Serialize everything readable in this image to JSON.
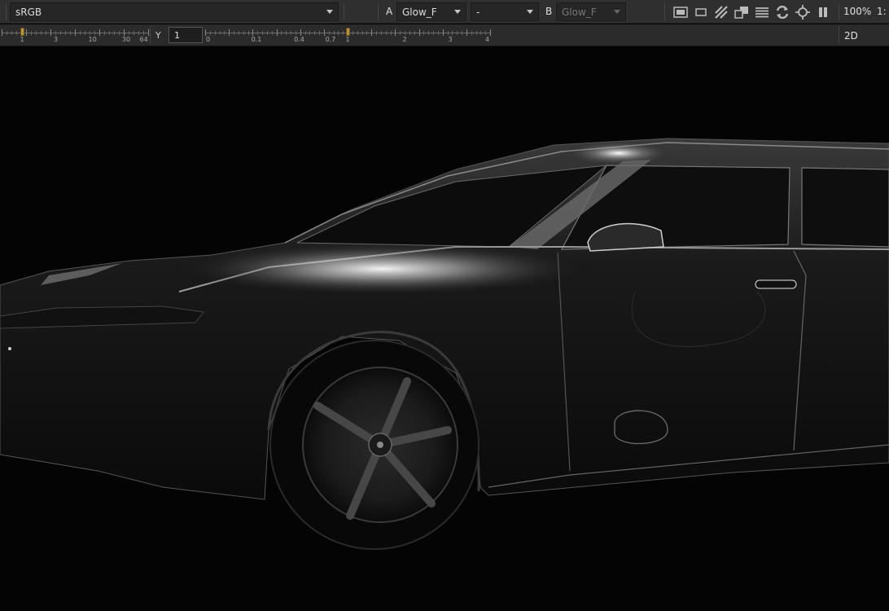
{
  "toolbar": {
    "colorspace": "sRGB",
    "a_label": "A",
    "a_input": "Glow_F",
    "operation": "-",
    "b_label": "B",
    "b_input": "Glow_F",
    "zoom": "100%",
    "ratio": "1:"
  },
  "icons": [
    "roi-icon",
    "frame-icon",
    "checkerboard-icon",
    "overlay-icon",
    "scanlines-icon",
    "refresh-icon",
    "target-icon",
    "pause-icon"
  ],
  "gain_slider": {
    "labels": [
      "1",
      "3",
      "10",
      "30",
      "64"
    ],
    "value": 1
  },
  "gamma": {
    "label": "Y",
    "value": "1",
    "labels": [
      "0",
      "0.1",
      "0.4",
      "0.7",
      "1",
      "2",
      "3",
      "4"
    ]
  },
  "view_mode": "2D",
  "colors": {
    "toolbar_bg": "#2f2f2f",
    "viewer_bg": "#040404",
    "handle": "#b8953a"
  }
}
